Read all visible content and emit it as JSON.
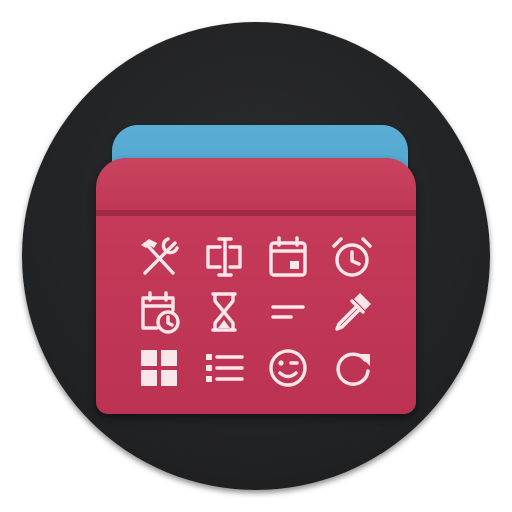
{
  "app_icon": {
    "colors": {
      "background_disc": "#222325",
      "front_card": "#c23856",
      "back_card": "#4aa3cc",
      "glyph": "#fbe6ea"
    },
    "icons": [
      "tools-icon",
      "text-field-icon",
      "calendar-event-icon",
      "alarm-clock-icon",
      "calendar-clock-icon",
      "hourglass-icon",
      "short-text-icon",
      "eyedropper-icon",
      "grid-view-icon",
      "list-icon",
      "wink-face-icon",
      "refresh-icon"
    ]
  }
}
